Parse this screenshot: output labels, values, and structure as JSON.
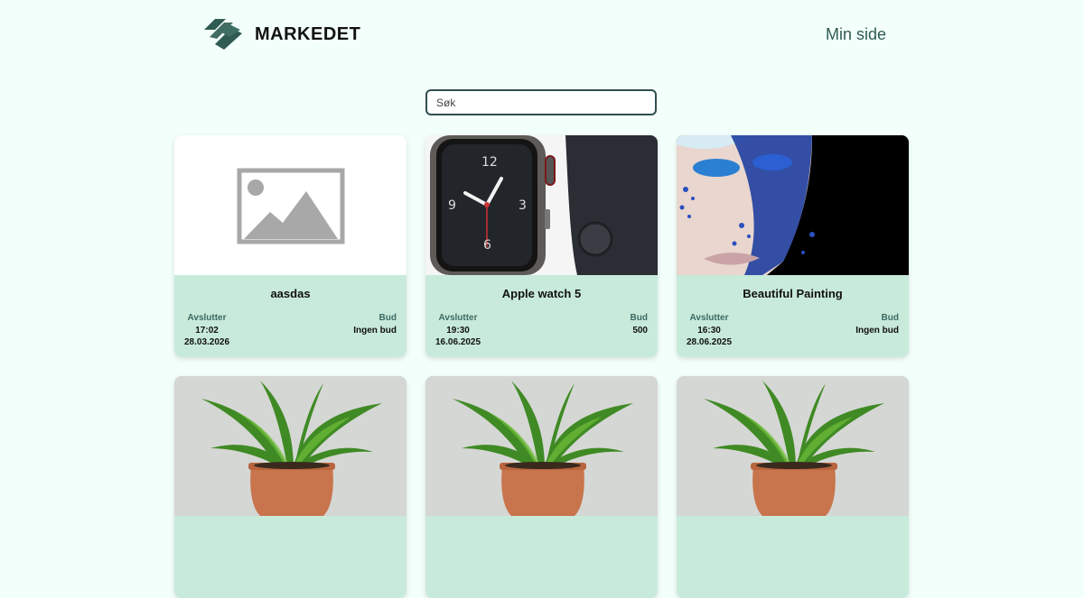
{
  "header": {
    "logo_text": "MARKEDET",
    "logo_icon": "handshake-icon",
    "nav_link": "Min side"
  },
  "search": {
    "placeholder": "Søk"
  },
  "labels": {
    "ends": "Avslutter",
    "bid": "Bud"
  },
  "colors": {
    "background": "#f3fffb",
    "card": "#c8eadb",
    "accent": "#2f5b52"
  },
  "listings": [
    {
      "title": "aasdas",
      "time": "17:02",
      "date": "28.03.2026",
      "bid": "Ingen bud",
      "image": "image-placeholder-icon"
    },
    {
      "title": "Apple watch 5",
      "time": "19:30",
      "date": "16.06.2025",
      "bid": "500",
      "image": "apple-watch-photo"
    },
    {
      "title": "Beautiful Painting",
      "time": "16:30",
      "date": "28.06.2025",
      "bid": "Ingen bud",
      "image": "face-glitter-painting"
    },
    {
      "image": "potted-plant-photo"
    },
    {
      "image": "potted-plant-photo"
    },
    {
      "image": "potted-plant-photo"
    }
  ]
}
